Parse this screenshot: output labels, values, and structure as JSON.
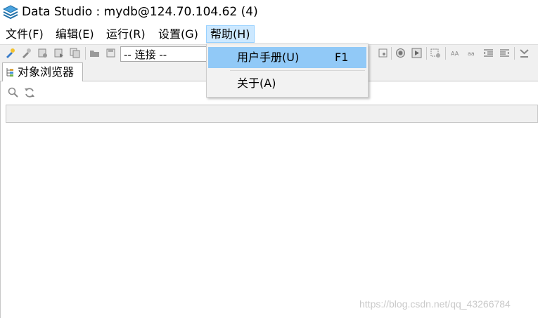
{
  "window": {
    "title": "Data Studio : mydb@124.70.104.62 (4)",
    "icon": "data-studio-logo-icon"
  },
  "menubar": {
    "items": [
      {
        "label": "文件(F)"
      },
      {
        "label": "编辑(E)"
      },
      {
        "label": "运行(R)"
      },
      {
        "label": "设置(G)"
      },
      {
        "label": "帮助(H)",
        "active": true
      }
    ]
  },
  "toolbar": {
    "connection_combo": "-- 连接 --"
  },
  "help_menu": {
    "items": [
      {
        "label": "用户手册(U)",
        "shortcut": "F1",
        "highlighted": true
      },
      {
        "label": "关于(A)",
        "shortcut": ""
      }
    ]
  },
  "object_browser": {
    "tab_label": "对象浏览器"
  },
  "watermark": "https://blog.csdn.net/qq_43266784",
  "colors": {
    "menu_active_bg": "#cce8ff",
    "dropdown_highlight": "#91c9f7",
    "toolbar_bg": "#f0f0f0"
  }
}
